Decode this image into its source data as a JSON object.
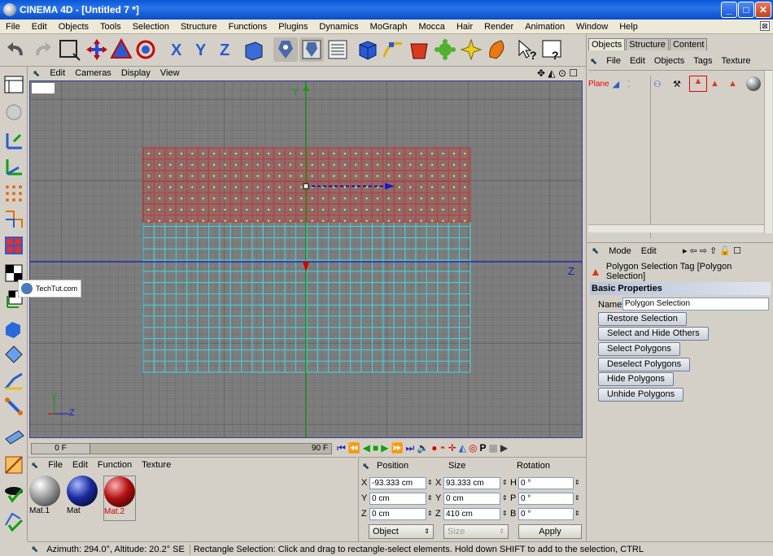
{
  "window": {
    "title": "CINEMA 4D - [Untitled 7 *]",
    "minimize": "_",
    "maximize": "□",
    "close": "✕"
  },
  "menu": [
    "File",
    "Edit",
    "Objects",
    "Tools",
    "Selection",
    "Structure",
    "Functions",
    "Plugins",
    "Dynamics",
    "MoGraph",
    "Mocca",
    "Hair",
    "Render",
    "Animation",
    "Window",
    "Help"
  ],
  "viewport": {
    "menu": [
      "Edit",
      "Cameras",
      "Display",
      "View"
    ],
    "axis_y": "Y",
    "axis_z": "Z",
    "mini_y": "Y",
    "mini_z": "Z",
    "watermark": "TechTut.com"
  },
  "timeline": {
    "current": "0 F",
    "end": "90 F"
  },
  "materials": {
    "menu": [
      "File",
      "Edit",
      "Function",
      "Texture"
    ],
    "items": [
      {
        "label": "Mat.1",
        "color": "#9a9a9a"
      },
      {
        "label": "Mat",
        "color": "#1a2aa0"
      },
      {
        "label": "Mat.2",
        "color": "#b01010"
      }
    ]
  },
  "coords": {
    "headers": [
      "Position",
      "Size",
      "Rotation"
    ],
    "rows": [
      {
        "pos_axis": "X",
        "pos": "-93.333 cm",
        "size_axis": "X",
        "size": "93.333 cm",
        "rot_axis": "H",
        "rot": "0 °"
      },
      {
        "pos_axis": "Y",
        "pos": "0 cm",
        "size_axis": "Y",
        "size": "0 cm",
        "rot_axis": "P",
        "rot": "0 °"
      },
      {
        "pos_axis": "Z",
        "pos": "0 cm",
        "size_axis": "Z",
        "size": "410 cm",
        "rot_axis": "B",
        "rot": "0 °"
      }
    ],
    "mode": "Object",
    "size_mode": "Size",
    "apply": "Apply"
  },
  "status": {
    "left": "Azimuth: 294.0°, Altitude: 20.2° SE",
    "right": "Rectangle Selection: Click and drag to rectangle-select elements. Hold down SHIFT to add to the selection, CTRL"
  },
  "objects_panel": {
    "tabs": [
      "Objects",
      "Structure",
      "Content"
    ],
    "menu": [
      "File",
      "Edit",
      "Objects",
      "Tags",
      "Texture"
    ],
    "object_name": "Plane"
  },
  "attributes": {
    "menu": [
      "Mode",
      "Edit"
    ],
    "tag_title": "Polygon Selection Tag [Polygon Selection]",
    "section": "Basic Properties",
    "name_label": "Name",
    "name_value": "Polygon Selection",
    "buttons": [
      "Restore Selection",
      "Select and Hide Others",
      "Select Polygons",
      "Deselect Polygons",
      "Hide Polygons",
      "Unhide Polygons"
    ]
  },
  "colors": {
    "accent": "#0a4cc8",
    "grid_red": "#d03030",
    "grid_cyan": "#40d8e0",
    "axis_green": "#10a010",
    "axis_blue": "#1010c0"
  }
}
